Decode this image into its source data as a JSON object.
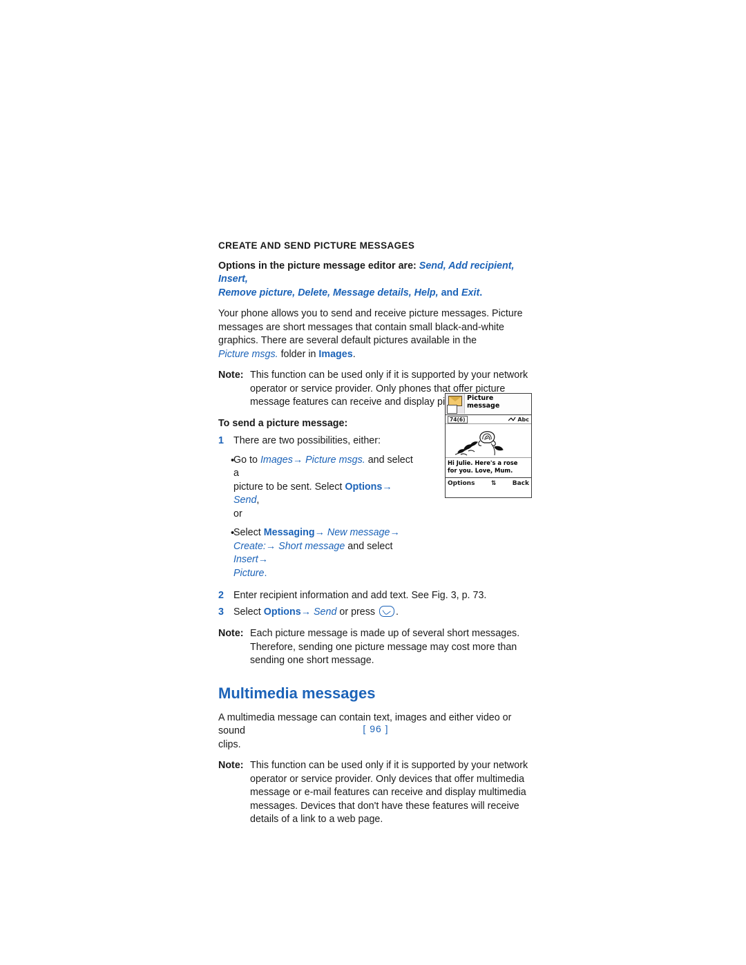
{
  "document": {
    "section_heading": "CREATE AND SEND PICTURE MESSAGES",
    "options_intro": {
      "lead": "Options in the picture message editor are: ",
      "items_line1": "Send, Add recipient, Insert,",
      "items_line2_a": "Remove picture, Delete, Message details, Help,",
      "items_line2_and": " and ",
      "items_line2_b": "Exit",
      "period": "."
    },
    "body_paragraph": {
      "line1": "Your phone allows you to send and receive picture messages. Picture",
      "line2": "messages are short messages that contain small black-and-white",
      "line3": "graphics. There are several default pictures available in the",
      "line4_a": "Picture msgs.",
      "line4_b": " folder in ",
      "line4_c": "Images",
      "line4_d": "."
    },
    "note1": {
      "label": "Note:",
      "line1": "This function can be used only if it is supported by your network",
      "line2": "operator or service provider. Only phones that offer picture",
      "line3": "message features can receive and display picture messages."
    },
    "sub_heading": "To send a picture message:",
    "step1": {
      "number": "1",
      "text": "There are two possibilities, either:"
    },
    "bullet1": {
      "dot": "•",
      "seg1": "Go to ",
      "seg2": "Images",
      "arrow1": "→",
      "seg3": " Picture msgs.",
      "seg4": " and select a",
      "line2_a": "picture to be sent. Select ",
      "line2_b": "Options",
      "line2_arrow": "→",
      "line2_c": " Send",
      "line2_d": ",",
      "line3": "or"
    },
    "bullet2": {
      "dot": "•",
      "seg1": "Select ",
      "seg2": "Messaging",
      "arrow1": "→",
      "seg3": " New message",
      "arrow2": "→",
      "line2_a": "Create:",
      "line2_arrow1": "→",
      "line2_b": " Short message",
      "line2_c": " and select ",
      "line2_d": "Insert",
      "line2_arrow2": "→",
      "line3_a": "Picture",
      "line3_b": "."
    },
    "step2": {
      "number": "2",
      "text": "Enter recipient information and add text. See Fig. 3, p. 73."
    },
    "step3": {
      "number": "3",
      "seg1": "Select ",
      "seg2": "Options",
      "arrow": "→",
      "seg3": " Send",
      "seg4": " or press ",
      "seg5": "."
    },
    "note2": {
      "label": "Note:",
      "line1": "Each picture message is made up of several short messages.",
      "line2": "Therefore, sending one picture message may cost more than",
      "line3": "sending one short message."
    },
    "multimedia": {
      "title": "Multimedia messages",
      "intro_line1": "A multimedia message can contain text, images and either video or sound",
      "intro_line2": "clips.",
      "note_label": "Note:",
      "note_line1": "This function can be used only if it is supported by your network",
      "note_line2": "operator or service provider. Only devices that offer multimedia",
      "note_line3": "message or e-mail features can receive and display multimedia",
      "note_line4": "messages. Devices that don't have these features will receive",
      "note_line5": "details of a link to a web page."
    },
    "page_number": "[ 96 ]"
  },
  "phone_screenshot": {
    "title_line1": "Picture",
    "title_line2": "message",
    "char_count": "74",
    "count_suffix": "(6)",
    "input_mode": "Abc",
    "message_line1": "Hi Julie. Here's a rose",
    "message_line2": "for you. Love, Mum.",
    "softkey_left": "Options",
    "softkey_middle": "⇅",
    "softkey_right": "Back",
    "icons": {
      "title": "envelope-picture-icon",
      "scroll": "up-down-scroll-icon",
      "signal": "signal-icon"
    }
  },
  "colors": {
    "accent_blue": "#1c63b8",
    "text": "#1a1a1a",
    "background": "#ffffff"
  }
}
